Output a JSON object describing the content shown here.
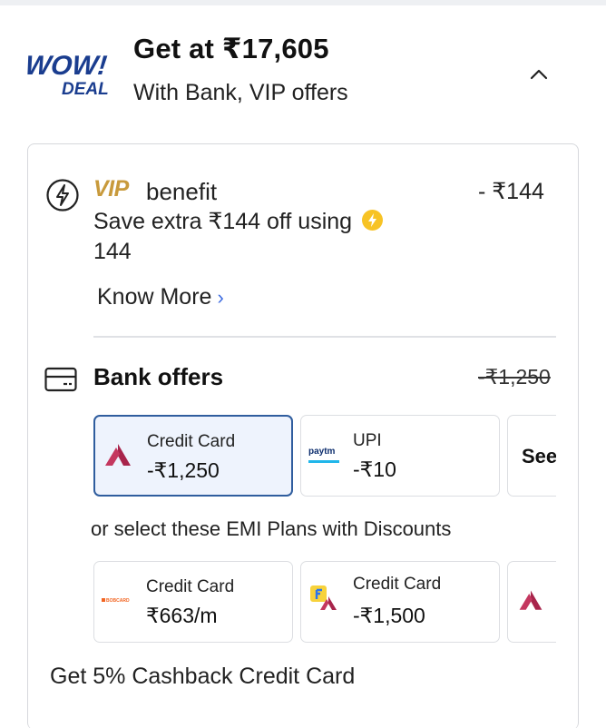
{
  "header": {
    "logo_top": "WOW!",
    "logo_bottom": "DEAL",
    "title": "Get at  ₹17,605",
    "subtitle": "With Bank, VIP offers"
  },
  "vip": {
    "brand": "VIP",
    "benefit_label": "benefit",
    "amount": "- ₹144",
    "description": "Save extra ₹144 off using",
    "coins": "144",
    "know_more": "Know More"
  },
  "bank_offers": {
    "title": "Bank offers",
    "amount": "-₹1,250",
    "options": [
      {
        "label": "Credit Card",
        "value": "-₹1,250",
        "icon": "axis-bank-icon",
        "selected": true
      },
      {
        "label": "UPI",
        "value": "-₹10",
        "icon": "paytm-icon",
        "icon_text": "paytm",
        "selected": false
      }
    ],
    "see_more": "See"
  },
  "emi": {
    "caption": "or select these EMI Plans with Discounts",
    "options": [
      {
        "label": "Credit Card",
        "value": "₹663/m",
        "icon": "bobcard-icon",
        "icon_text": "BOBCARD"
      },
      {
        "label": "Credit Card",
        "value": "-₹1,500",
        "icon": "flipkart-axis-icon"
      }
    ]
  },
  "footer": {
    "cashback": "Get 5% Cashback Credit Card"
  },
  "colors": {
    "accent_blue": "#2f5d9e",
    "selected_bg": "#eef3fd",
    "wow_blue": "#1a3d8f",
    "coin_yellow": "#f7c325",
    "axis_maroon": "#a8244b"
  }
}
